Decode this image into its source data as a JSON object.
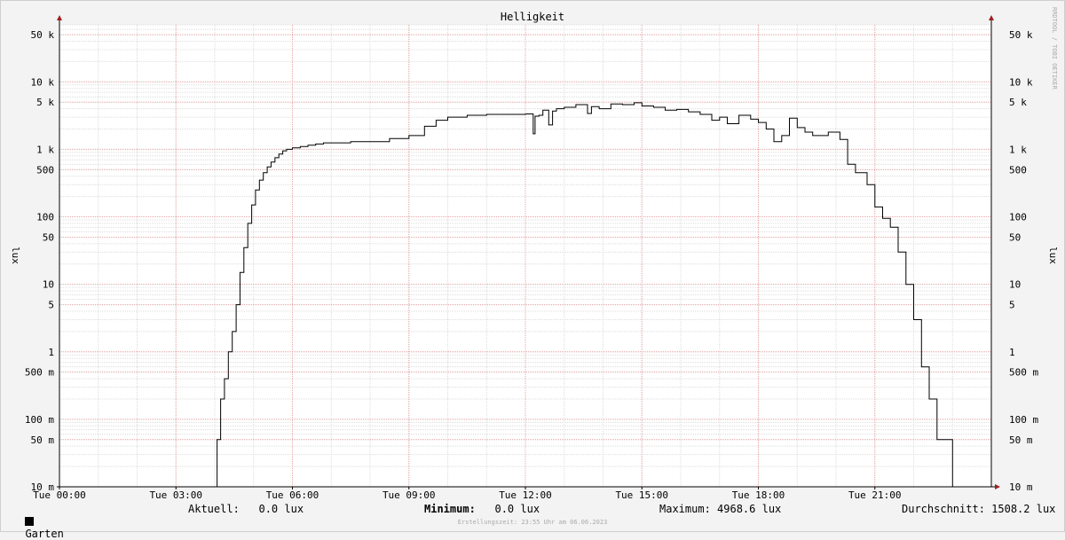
{
  "chart_data": {
    "type": "line",
    "title": "Helligkeit",
    "ylabel": "lux",
    "yscale": "log",
    "ylim": [
      0.01,
      70000
    ],
    "xlim": [
      0,
      24
    ],
    "x_ticks": [
      {
        "value": 0,
        "label": "Tue 00:00"
      },
      {
        "value": 3,
        "label": "Tue 03:00"
      },
      {
        "value": 6,
        "label": "Tue 06:00"
      },
      {
        "value": 9,
        "label": "Tue 09:00"
      },
      {
        "value": 12,
        "label": "Tue 12:00"
      },
      {
        "value": 15,
        "label": "Tue 15:00"
      },
      {
        "value": 18,
        "label": "Tue 18:00"
      },
      {
        "value": 21,
        "label": "Tue 21:00"
      }
    ],
    "y_ticks": [
      {
        "value": 0.01,
        "label": "10 m"
      },
      {
        "value": 0.05,
        "label": "50 m"
      },
      {
        "value": 0.1,
        "label": "100 m"
      },
      {
        "value": 0.5,
        "label": "500 m"
      },
      {
        "value": 1,
        "label": "1"
      },
      {
        "value": 5,
        "label": "5"
      },
      {
        "value": 10,
        "label": "10"
      },
      {
        "value": 50,
        "label": "50"
      },
      {
        "value": 100,
        "label": "100"
      },
      {
        "value": 500,
        "label": "500"
      },
      {
        "value": 1000,
        "label": "1 k"
      },
      {
        "value": 5000,
        "label": "5 k"
      },
      {
        "value": 10000,
        "label": "10 k"
      },
      {
        "value": 50000,
        "label": "50 k"
      }
    ],
    "grid": true,
    "colors": {
      "grid_major": "#e6a4a4",
      "grid_minor": "#dcdcdc",
      "line": "#000000",
      "axis_arrow": "#a02020"
    },
    "series": [
      {
        "name": "Garten",
        "x": [
          0,
          4.05,
          4.06,
          4.15,
          4.25,
          4.35,
          4.45,
          4.55,
          4.65,
          4.75,
          4.85,
          4.95,
          5.05,
          5.15,
          5.25,
          5.35,
          5.45,
          5.55,
          5.65,
          5.75,
          5.85,
          6.0,
          6.2,
          6.4,
          6.6,
          6.8,
          7.0,
          7.5,
          8.0,
          8.5,
          9.0,
          9.4,
          9.7,
          10.0,
          10.5,
          11.0,
          11.5,
          12.0,
          12.1,
          12.2,
          12.25,
          12.35,
          12.45,
          12.6,
          12.7,
          12.8,
          13.0,
          13.3,
          13.6,
          13.7,
          13.9,
          14.2,
          14.5,
          14.8,
          15.0,
          15.3,
          15.6,
          15.9,
          16.2,
          16.5,
          16.8,
          17.0,
          17.2,
          17.5,
          17.8,
          18.0,
          18.2,
          18.4,
          18.6,
          18.8,
          19.0,
          19.2,
          19.4,
          19.8,
          20.1,
          20.3,
          20.5,
          20.8,
          21.0,
          21.2,
          21.4,
          21.6,
          21.8,
          22.0,
          22.2,
          22.4,
          22.6,
          22.8,
          23.0,
          23.05,
          24.0
        ],
        "values": [
          0.01,
          0.01,
          0.05,
          0.2,
          0.4,
          1.0,
          2.0,
          5.0,
          15,
          35,
          80,
          150,
          250,
          350,
          450,
          550,
          650,
          750,
          850,
          950,
          1000,
          1050,
          1100,
          1150,
          1200,
          1250,
          1250,
          1300,
          1300,
          1450,
          1600,
          2200,
          2700,
          3000,
          3200,
          3300,
          3300,
          3350,
          3350,
          1700,
          3100,
          3200,
          3800,
          2300,
          3700,
          4000,
          4200,
          4600,
          3400,
          4300,
          4000,
          4700,
          4600,
          4900,
          4400,
          4200,
          3800,
          3900,
          3600,
          3300,
          2700,
          3000,
          2400,
          3200,
          2800,
          2500,
          2000,
          1300,
          1600,
          2900,
          2100,
          1800,
          1600,
          1800,
          1400,
          600,
          450,
          300,
          140,
          95,
          70,
          30,
          10,
          3.0,
          0.6,
          0.2,
          0.05,
          0.05,
          0.01,
          0.01,
          0.01
        ]
      }
    ]
  },
  "axis": {
    "ylabel_left": "lux",
    "ylabel_right": "lux",
    "side_text": "RRDTOOL / TOBI OETIKER"
  },
  "legend": {
    "swatch_color": "#000000",
    "series_name": "Garten",
    "current_label": "Aktuell:",
    "current_value": "0.0 lux",
    "min_label": "Minimum:",
    "min_value": "0.0 lux",
    "max_label": "Maximum:",
    "max_value": "4968.6 lux",
    "avg_label": "Durchschnitt:",
    "avg_value": "1508.2 lux"
  },
  "footer": "Erstellungszeit: 23:55 Uhr am 06.06.2023"
}
